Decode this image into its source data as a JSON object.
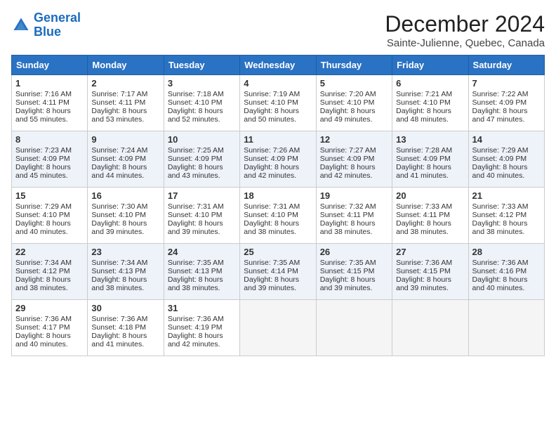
{
  "header": {
    "logo_line1": "General",
    "logo_line2": "Blue",
    "month_title": "December 2024",
    "location": "Sainte-Julienne, Quebec, Canada"
  },
  "days_of_week": [
    "Sunday",
    "Monday",
    "Tuesday",
    "Wednesday",
    "Thursday",
    "Friday",
    "Saturday"
  ],
  "weeks": [
    [
      {
        "day": "1",
        "lines": [
          "Sunrise: 7:16 AM",
          "Sunset: 4:11 PM",
          "Daylight: 8 hours",
          "and 55 minutes."
        ]
      },
      {
        "day": "2",
        "lines": [
          "Sunrise: 7:17 AM",
          "Sunset: 4:11 PM",
          "Daylight: 8 hours",
          "and 53 minutes."
        ]
      },
      {
        "day": "3",
        "lines": [
          "Sunrise: 7:18 AM",
          "Sunset: 4:10 PM",
          "Daylight: 8 hours",
          "and 52 minutes."
        ]
      },
      {
        "day": "4",
        "lines": [
          "Sunrise: 7:19 AM",
          "Sunset: 4:10 PM",
          "Daylight: 8 hours",
          "and 50 minutes."
        ]
      },
      {
        "day": "5",
        "lines": [
          "Sunrise: 7:20 AM",
          "Sunset: 4:10 PM",
          "Daylight: 8 hours",
          "and 49 minutes."
        ]
      },
      {
        "day": "6",
        "lines": [
          "Sunrise: 7:21 AM",
          "Sunset: 4:10 PM",
          "Daylight: 8 hours",
          "and 48 minutes."
        ]
      },
      {
        "day": "7",
        "lines": [
          "Sunrise: 7:22 AM",
          "Sunset: 4:09 PM",
          "Daylight: 8 hours",
          "and 47 minutes."
        ]
      }
    ],
    [
      {
        "day": "8",
        "lines": [
          "Sunrise: 7:23 AM",
          "Sunset: 4:09 PM",
          "Daylight: 8 hours",
          "and 45 minutes."
        ]
      },
      {
        "day": "9",
        "lines": [
          "Sunrise: 7:24 AM",
          "Sunset: 4:09 PM",
          "Daylight: 8 hours",
          "and 44 minutes."
        ]
      },
      {
        "day": "10",
        "lines": [
          "Sunrise: 7:25 AM",
          "Sunset: 4:09 PM",
          "Daylight: 8 hours",
          "and 43 minutes."
        ]
      },
      {
        "day": "11",
        "lines": [
          "Sunrise: 7:26 AM",
          "Sunset: 4:09 PM",
          "Daylight: 8 hours",
          "and 42 minutes."
        ]
      },
      {
        "day": "12",
        "lines": [
          "Sunrise: 7:27 AM",
          "Sunset: 4:09 PM",
          "Daylight: 8 hours",
          "and 42 minutes."
        ]
      },
      {
        "day": "13",
        "lines": [
          "Sunrise: 7:28 AM",
          "Sunset: 4:09 PM",
          "Daylight: 8 hours",
          "and 41 minutes."
        ]
      },
      {
        "day": "14",
        "lines": [
          "Sunrise: 7:29 AM",
          "Sunset: 4:09 PM",
          "Daylight: 8 hours",
          "and 40 minutes."
        ]
      }
    ],
    [
      {
        "day": "15",
        "lines": [
          "Sunrise: 7:29 AM",
          "Sunset: 4:10 PM",
          "Daylight: 8 hours",
          "and 40 minutes."
        ]
      },
      {
        "day": "16",
        "lines": [
          "Sunrise: 7:30 AM",
          "Sunset: 4:10 PM",
          "Daylight: 8 hours",
          "and 39 minutes."
        ]
      },
      {
        "day": "17",
        "lines": [
          "Sunrise: 7:31 AM",
          "Sunset: 4:10 PM",
          "Daylight: 8 hours",
          "and 39 minutes."
        ]
      },
      {
        "day": "18",
        "lines": [
          "Sunrise: 7:31 AM",
          "Sunset: 4:10 PM",
          "Daylight: 8 hours",
          "and 38 minutes."
        ]
      },
      {
        "day": "19",
        "lines": [
          "Sunrise: 7:32 AM",
          "Sunset: 4:11 PM",
          "Daylight: 8 hours",
          "and 38 minutes."
        ]
      },
      {
        "day": "20",
        "lines": [
          "Sunrise: 7:33 AM",
          "Sunset: 4:11 PM",
          "Daylight: 8 hours",
          "and 38 minutes."
        ]
      },
      {
        "day": "21",
        "lines": [
          "Sunrise: 7:33 AM",
          "Sunset: 4:12 PM",
          "Daylight: 8 hours",
          "and 38 minutes."
        ]
      }
    ],
    [
      {
        "day": "22",
        "lines": [
          "Sunrise: 7:34 AM",
          "Sunset: 4:12 PM",
          "Daylight: 8 hours",
          "and 38 minutes."
        ]
      },
      {
        "day": "23",
        "lines": [
          "Sunrise: 7:34 AM",
          "Sunset: 4:13 PM",
          "Daylight: 8 hours",
          "and 38 minutes."
        ]
      },
      {
        "day": "24",
        "lines": [
          "Sunrise: 7:35 AM",
          "Sunset: 4:13 PM",
          "Daylight: 8 hours",
          "and 38 minutes."
        ]
      },
      {
        "day": "25",
        "lines": [
          "Sunrise: 7:35 AM",
          "Sunset: 4:14 PM",
          "Daylight: 8 hours",
          "and 39 minutes."
        ]
      },
      {
        "day": "26",
        "lines": [
          "Sunrise: 7:35 AM",
          "Sunset: 4:15 PM",
          "Daylight: 8 hours",
          "and 39 minutes."
        ]
      },
      {
        "day": "27",
        "lines": [
          "Sunrise: 7:36 AM",
          "Sunset: 4:15 PM",
          "Daylight: 8 hours",
          "and 39 minutes."
        ]
      },
      {
        "day": "28",
        "lines": [
          "Sunrise: 7:36 AM",
          "Sunset: 4:16 PM",
          "Daylight: 8 hours",
          "and 40 minutes."
        ]
      }
    ],
    [
      {
        "day": "29",
        "lines": [
          "Sunrise: 7:36 AM",
          "Sunset: 4:17 PM",
          "Daylight: 8 hours",
          "and 40 minutes."
        ]
      },
      {
        "day": "30",
        "lines": [
          "Sunrise: 7:36 AM",
          "Sunset: 4:18 PM",
          "Daylight: 8 hours",
          "and 41 minutes."
        ]
      },
      {
        "day": "31",
        "lines": [
          "Sunrise: 7:36 AM",
          "Sunset: 4:19 PM",
          "Daylight: 8 hours",
          "and 42 minutes."
        ]
      },
      {
        "day": "",
        "lines": []
      },
      {
        "day": "",
        "lines": []
      },
      {
        "day": "",
        "lines": []
      },
      {
        "day": "",
        "lines": []
      }
    ]
  ]
}
